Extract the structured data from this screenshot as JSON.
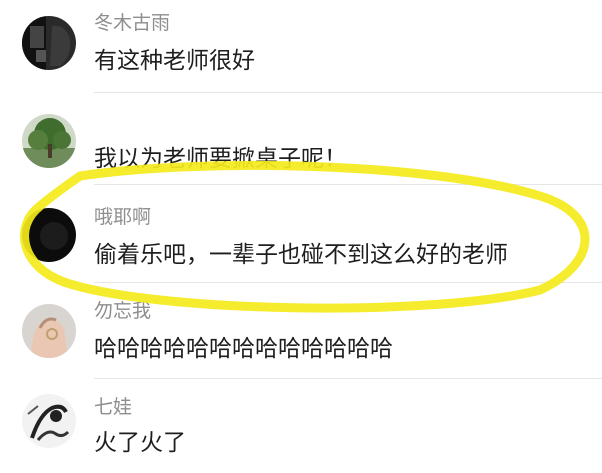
{
  "comments": [
    {
      "username": "冬木古雨",
      "text": "有这种老师很好",
      "avatar_icon": "dark-portrait-avatar"
    },
    {
      "username": "",
      "text": "我以为老师要掀桌子呢！",
      "avatar_icon": "green-tree-avatar"
    },
    {
      "username": "哦耶啊",
      "text": "偷着乐吧，一辈子也碰不到这么好的老师",
      "avatar_icon": "black-circle-avatar"
    },
    {
      "username": "勿忘我",
      "text": "哈哈哈哈哈哈哈哈哈哈哈哈哈",
      "avatar_icon": "hand-ring-avatar"
    },
    {
      "username": "七娃",
      "text": "火了火了",
      "avatar_icon": "sketch-figure-avatar"
    }
  ],
  "highlight_color": "#f4ea1c"
}
